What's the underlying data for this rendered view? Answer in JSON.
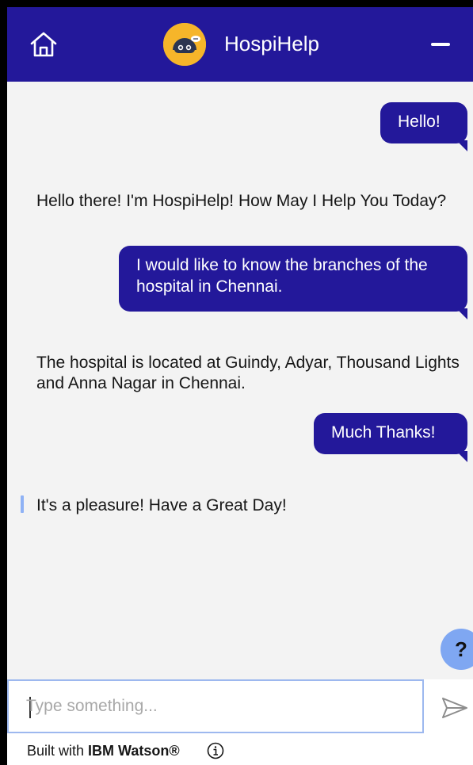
{
  "header": {
    "title": "HospiHelp",
    "home_icon": "home-icon",
    "logo_icon": "robot-logo",
    "minimize_icon": "minimize-icon",
    "background": "#23189a"
  },
  "messages": [
    {
      "sender": "user",
      "text": "Hello!"
    },
    {
      "sender": "bot",
      "text": "Hello there! I'm HospiHelp! How May I Help You Today?"
    },
    {
      "sender": "user",
      "text": "I would like to know the branches of the hospital in Chennai."
    },
    {
      "sender": "bot",
      "text": "The hospital is located at Guindy, Adyar, Thousand Lights and Anna Nagar in Chennai."
    },
    {
      "sender": "user",
      "text": "Much Thanks!"
    },
    {
      "sender": "bot",
      "text": "It's a pleasure! Have a Great Day!"
    }
  ],
  "help_button": {
    "label": "?"
  },
  "composer": {
    "placeholder": "Type something...",
    "value": "",
    "send_icon": "send-icon"
  },
  "footer": {
    "prefix": "Built with",
    "brand": "IBM Watson®",
    "info_icon": "info-icon"
  },
  "colors": {
    "accent": "#23189a",
    "chat_background": "#f3f3f3",
    "help_button": "#7fa7f2",
    "input_border": "#9db8ef"
  }
}
